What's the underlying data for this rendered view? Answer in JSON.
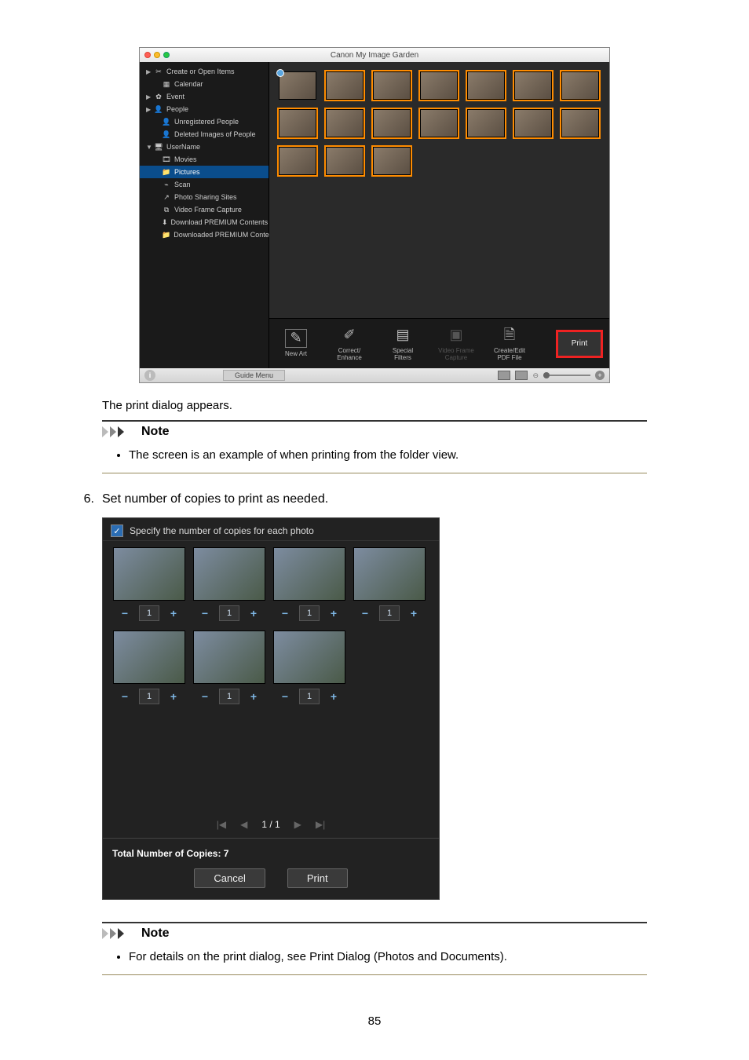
{
  "app": {
    "title": "Canon My Image Garden",
    "sidebar": [
      {
        "label": "Create or Open Items",
        "icon": "✂",
        "caret": "▶"
      },
      {
        "label": "Calendar",
        "icon": "▦",
        "indent": true
      },
      {
        "label": "Event",
        "icon": "✿",
        "caret": "▶"
      },
      {
        "label": "People",
        "icon": "👤",
        "caret": "▶"
      },
      {
        "label": "Unregistered People",
        "icon": "👤",
        "indent": true
      },
      {
        "label": "Deleted Images of People",
        "icon": "👤",
        "indent": true
      },
      {
        "label": "UserName",
        "icon": "🖥",
        "caret": "▼"
      },
      {
        "label": "Movies",
        "icon": "🎞",
        "indent": true
      },
      {
        "label": "Pictures",
        "icon": "📁",
        "indent": true,
        "caret": "▶",
        "selected": true
      },
      {
        "label": "Scan",
        "icon": "⌁",
        "indent": true
      },
      {
        "label": "Photo Sharing Sites",
        "icon": "↗",
        "indent": true
      },
      {
        "label": "Video Frame Capture",
        "icon": "⧉",
        "indent": true
      },
      {
        "label": "Download PREMIUM Contents",
        "icon": "⬇",
        "indent": true
      },
      {
        "label": "Downloaded PREMIUM Contents",
        "icon": "📁",
        "indent": true
      }
    ],
    "thumb_count": 17,
    "thumb_selected": [
      1,
      2,
      3,
      4,
      5,
      6,
      7,
      8,
      9,
      10,
      11,
      12,
      13,
      14,
      15,
      16
    ],
    "toolbar": {
      "new_art": "New Art",
      "correct": "Correct/\nEnhance",
      "special": "Special\nFilters",
      "video": "Video Frame\nCapture",
      "pdf": "Create/Edit\nPDF File",
      "print": "Print"
    },
    "status": {
      "guide": "Guide Menu"
    }
  },
  "text": {
    "after_app": "The print dialog appears.",
    "note_label": "Note",
    "note1_item": "The screen is an example of when printing from the folder view.",
    "step6_num": "6.",
    "step6_text": "Set number of copies to print as needed.",
    "note2_item": "For details on the print dialog, see Print Dialog (Photos and Documents)."
  },
  "copies": {
    "header": "Specify the number of copies for each photo",
    "photos": [
      {
        "count": "1"
      },
      {
        "count": "1"
      },
      {
        "count": "1"
      },
      {
        "count": "1"
      },
      {
        "count": "1"
      },
      {
        "count": "1"
      },
      {
        "count": "1"
      }
    ],
    "pager": {
      "first": "|◀",
      "prev": "◀",
      "current": "1 / 1",
      "next": "▶",
      "last": "▶|"
    },
    "total": "Total Number of Copies: 7",
    "cancel": "Cancel",
    "print": "Print"
  },
  "page_number": "85"
}
